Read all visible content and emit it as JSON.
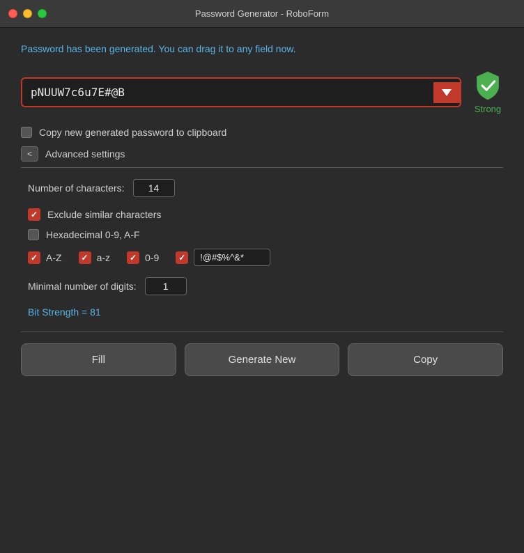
{
  "titleBar": {
    "title": "Password Generator - RoboForm"
  },
  "notice": {
    "text": "Password has been generated. You can drag it to any field now."
  },
  "passwordField": {
    "value": "pNUUW7c6u7E#@B",
    "dropdownArrow": "▾"
  },
  "strengthBadge": {
    "label": "Strong"
  },
  "clipboardCheckbox": {
    "label": "Copy new generated password to clipboard",
    "checked": false
  },
  "advancedSettings": {
    "toggleLabel": "<",
    "label": "Advanced settings",
    "numCharsLabel": "Number of characters:",
    "numCharsValue": "14",
    "excludeSimilarLabel": "Exclude similar characters",
    "excludeSimilarChecked": true,
    "hexadecimalLabel": "Hexadecimal 0-9, A-F",
    "hexadecimalChecked": false,
    "charOptions": [
      {
        "id": "az_upper",
        "label": "A-Z",
        "checked": true
      },
      {
        "id": "az_lower",
        "label": "a-z",
        "checked": true
      },
      {
        "id": "digits",
        "label": "0-9",
        "checked": true
      },
      {
        "id": "special",
        "label": "",
        "checked": true,
        "inputValue": "!@#$%^&*"
      }
    ],
    "minDigitsLabel": "Minimal number of digits:",
    "minDigitsValue": "1",
    "bitStrength": "Bit Strength = 81"
  },
  "footer": {
    "fillLabel": "Fill",
    "generateLabel": "Generate New",
    "copyLabel": "Copy"
  }
}
